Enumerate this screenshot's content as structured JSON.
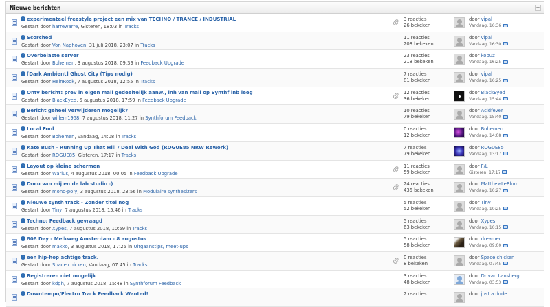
{
  "panel": {
    "title": "Nieuwe berichten",
    "collapse_symbol": "−"
  },
  "labels": {
    "started_by": "Gestart door",
    "in": "in",
    "by": "door"
  },
  "topics": [
    {
      "title": "experimenteel freestyle project een mix van TECHNO / TRANCE / INDUSTRIAL",
      "author": "harrewarre",
      "date": "Gisteren, 18:03",
      "forum": "Tracks",
      "attachment": true,
      "replies": "3 reacties",
      "views": "26 bekeken",
      "avatar": "default",
      "last_author": "vipal",
      "last_time": "Vandaag, 16:36"
    },
    {
      "title": "Scorched",
      "author": "Von Naphoven",
      "date": "31 juli 2018, 23:07",
      "forum": "Tracks",
      "attachment": false,
      "replies": "11 reacties",
      "views": "208 bekeken",
      "avatar": "default",
      "last_author": "vipal",
      "last_time": "Vandaag, 16:30"
    },
    {
      "title": "Overbelaste server",
      "author": "Bohemen",
      "date": "3 augustus 2018, 09:39",
      "forum": "Feedback Upgrade",
      "attachment": false,
      "replies": "23 reacties",
      "views": "218 bekeken",
      "avatar": "default",
      "last_author": "kobuz",
      "last_time": "Vandaag, 16:25"
    },
    {
      "title": "[Dark Ambient] Ghost City (Tips nodig)",
      "author": "HeinRook",
      "date": "7 augustus 2018, 12:55",
      "forum": "Tracks",
      "attachment": false,
      "replies": "7 reacties",
      "views": "81 bekeken",
      "avatar": "default",
      "last_author": "vipal",
      "last_time": "Vandaag, 16:25"
    },
    {
      "title": "Ontv bericht: prev in eigen mail gedeeltelijk aanw., inh van mail op Synthf inb leeg",
      "author": "BlackEyed",
      "date": "5 augustus 2018, 17:59",
      "forum": "Feedback Upgrade",
      "attachment": true,
      "replies": "12 reacties",
      "views": "36 bekeken",
      "avatar": "black",
      "last_author": "BlackEyed",
      "last_time": "Vandaag, 15:44"
    },
    {
      "title": "Bericht geheel verwijderen mogelijk?",
      "author": "willem1958",
      "date": "7 augustus 2018, 11:27",
      "forum": "Synthforum Feedback",
      "attachment": false,
      "replies": "10 reacties",
      "views": "79 bekeken",
      "avatar": "default",
      "last_author": "Acidfever",
      "last_time": "Vandaag, 15:40"
    },
    {
      "title": "Local Fool",
      "author": "Bohemen",
      "date": "Vandaag, 14:08",
      "forum": "Tracks",
      "attachment": false,
      "replies": "0 reacties",
      "views": "12 bekeken",
      "avatar": "purple",
      "last_author": "Bohemen",
      "last_time": "Vandaag, 14:08"
    },
    {
      "title": "Kate Bush - Running Up That Hill / Deal With God (ROGUE85 NRW Rework)",
      "author": "ROGUE85",
      "date": "Gisteren, 17:17",
      "forum": "Tracks",
      "attachment": false,
      "replies": "7 reacties",
      "views": "79 bekeken",
      "avatar": "blue",
      "last_author": "ROGUE85",
      "last_time": "Vandaag, 13:17"
    },
    {
      "title": "Layout op kleine schermen",
      "author": "Warius",
      "date": "4 augustus 2018, 00:05",
      "forum": "Feedback Upgrade",
      "attachment": true,
      "replies": "11 reacties",
      "views": "59 bekeken",
      "avatar": "default",
      "last_author": "F/L",
      "last_time": "Gisteren, 17:17"
    },
    {
      "title": "Docu van mij en de lab studio :)",
      "author": "mono-poly",
      "date": "3 augustus 2018, 23:56",
      "forum": "Modulaire synthesizers",
      "attachment": true,
      "replies": "24 reacties",
      "views": "436 bekeken",
      "avatar": "default",
      "last_author": "MatthewLeBlom",
      "last_time": "Vandaag, 10:27"
    },
    {
      "title": "Nieuwe synth track - Zonder titel nog",
      "author": "Tiny",
      "date": "7 augustus 2018, 15:46",
      "forum": "Tracks",
      "attachment": false,
      "replies": "5 reacties",
      "views": "52 bekeken",
      "avatar": "default",
      "last_author": "Tiny",
      "last_time": "Vandaag, 10:25"
    },
    {
      "title": "Techno: Feedback gevraagd",
      "author": "Xypes",
      "date": "7 augustus 2018, 10:59",
      "forum": "Tracks",
      "attachment": false,
      "replies": "5 reacties",
      "views": "63 bekeken",
      "avatar": "default",
      "last_author": "Xypes",
      "last_time": "Vandaag, 10:15"
    },
    {
      "title": "808 Day - Melkweg Amsterdam - 8 augustus",
      "author": "makko",
      "date": "3 augustus 2018, 17:25",
      "forum": "Uitgaanstips/ meet-ups",
      "attachment": false,
      "replies": "5 reacties",
      "views": "58 bekeken",
      "avatar": "photo",
      "last_author": "dreamer",
      "last_time": "Vandaag, 09:00"
    },
    {
      "title": "een hip-hop achtige track.",
      "author": "Space chicken",
      "date": "Vandaag, 07:45",
      "forum": "Tracks",
      "attachment": true,
      "replies": "0 reacties",
      "views": "8 bekeken",
      "avatar": "default",
      "last_author": "Space chicken",
      "last_time": "Vandaag, 07:45"
    },
    {
      "title": "Registreren niet mogelijk",
      "author": "kdgh",
      "date": "7 augustus 2018, 15:48",
      "forum": "Synthforum Feedback",
      "attachment": false,
      "replies": "3 reacties",
      "views": "48 bekeken",
      "avatar": "person",
      "last_author": "Dr van Lansberg",
      "last_time": "Vandaag, 03:53"
    },
    {
      "title": "Downtempo/Electro Track Feedback Wanted!",
      "author": "",
      "date": "",
      "forum": "",
      "attachment": false,
      "replies": "2 reacties",
      "views": "",
      "avatar": "default",
      "last_author": "just a dude",
      "last_time": ""
    }
  ]
}
